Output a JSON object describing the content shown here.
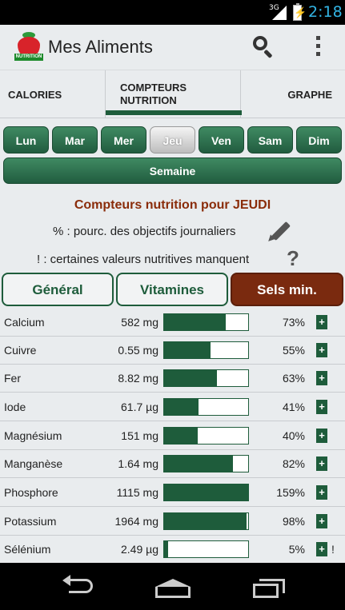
{
  "status_bar": {
    "network": "3G",
    "time": "2:18"
  },
  "app": {
    "title": "Mes Aliments",
    "logo_text": "NUTRITION"
  },
  "tabs": [
    {
      "label": "CALORIES",
      "selected": false
    },
    {
      "label": "COMPTEURS\nNUTRITION",
      "selected": true
    },
    {
      "label": "GRAPHE",
      "selected": false
    }
  ],
  "days": [
    {
      "label": "Lun",
      "selected": false
    },
    {
      "label": "Mar",
      "selected": false
    },
    {
      "label": "Mer",
      "selected": false
    },
    {
      "label": "Jeu",
      "selected": true
    },
    {
      "label": "Ven",
      "selected": false
    },
    {
      "label": "Sam",
      "selected": false
    },
    {
      "label": "Dim",
      "selected": false
    }
  ],
  "week_button": "Semaine",
  "heading": "Compteurs nutrition pour JEUDI",
  "info_percent": "% : pourc. des objectifs journaliers",
  "info_missing": "! : certaines valeurs nutritives manquent",
  "categories": [
    {
      "label": "Général",
      "selected": false
    },
    {
      "label": "Vitamines",
      "selected": false
    },
    {
      "label": "Sels min.",
      "selected": true
    }
  ],
  "rows": [
    {
      "name": "Calcium",
      "value": "582 mg",
      "percent": "73%",
      "fill": 0.73,
      "plus": "+",
      "warn": ""
    },
    {
      "name": "Cuivre",
      "value": "0.55 mg",
      "percent": "55%",
      "fill": 0.55,
      "plus": "+",
      "warn": ""
    },
    {
      "name": "Fer",
      "value": "8.82 mg",
      "percent": "63%",
      "fill": 0.63,
      "plus": "+",
      "warn": ""
    },
    {
      "name": "Iode",
      "value": "61.7 µg",
      "percent": "41%",
      "fill": 0.41,
      "plus": "+",
      "warn": ""
    },
    {
      "name": "Magnésium",
      "value": "151 mg",
      "percent": "40%",
      "fill": 0.4,
      "plus": "+",
      "warn": ""
    },
    {
      "name": "Manganèse",
      "value": "1.64 mg",
      "percent": "82%",
      "fill": 0.82,
      "plus": "+",
      "warn": ""
    },
    {
      "name": "Phosphore",
      "value": "1115 mg",
      "percent": "159%",
      "fill": 1.0,
      "plus": "+",
      "warn": ""
    },
    {
      "name": "Potassium",
      "value": "1964 mg",
      "percent": "98%",
      "fill": 0.98,
      "plus": "+",
      "warn": ""
    },
    {
      "name": "Sélénium",
      "value": "2.49 µg",
      "percent": "5%",
      "fill": 0.05,
      "plus": "+",
      "warn": "!"
    }
  ],
  "colors": {
    "accent": "#1e5c3b",
    "heading": "#8a2c0a",
    "selected_category": "#7a2a0f",
    "clock": "#33b5e5"
  }
}
